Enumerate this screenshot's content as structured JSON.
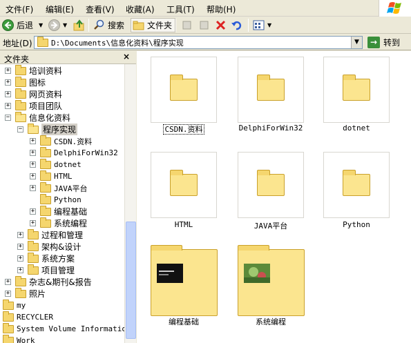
{
  "menu": {
    "file": "文件(F)",
    "edit": "编辑(E)",
    "view": "查看(V)",
    "favorites": "收藏(A)",
    "tools": "工具(T)",
    "help": "帮助(H)"
  },
  "toolbar": {
    "back": "后退",
    "search": "搜索",
    "folders": "文件夹"
  },
  "address": {
    "label": "地址(D)",
    "value": "D:\\Documents\\信息化资料\\程序实现",
    "go": "转到"
  },
  "folders_pane": {
    "title": "文件夹",
    "close": "×"
  },
  "tree": [
    {
      "label": "培训资料",
      "expander": "+"
    },
    {
      "label": "图标",
      "expander": "+"
    },
    {
      "label": "网页资料",
      "expander": "+"
    },
    {
      "label": "项目团队",
      "expander": "+"
    },
    {
      "label": "信息化资料",
      "expander": "−"
    },
    {
      "label": "程序实现",
      "expander": "−"
    },
    {
      "label": "CSDN.资料",
      "expander": "+"
    },
    {
      "label": "DelphiForWin32",
      "expander": "+"
    },
    {
      "label": "dotnet",
      "expander": "+"
    },
    {
      "label": "HTML",
      "expander": "+"
    },
    {
      "label": "JAVA平台",
      "expander": "+"
    },
    {
      "label": "Python",
      "expander": ""
    },
    {
      "label": "编程基础",
      "expander": "+"
    },
    {
      "label": "系统编程",
      "expander": "+"
    },
    {
      "label": "过程和管理",
      "expander": "+"
    },
    {
      "label": "架构&设计",
      "expander": "+"
    },
    {
      "label": "系统方案",
      "expander": "+"
    },
    {
      "label": "项目管理",
      "expander": "+"
    },
    {
      "label": "杂志&期刊&报告",
      "expander": "+"
    },
    {
      "label": "照片",
      "expander": "+"
    },
    {
      "label": "my",
      "expander": ""
    },
    {
      "label": "RECYCLER",
      "expander": ""
    },
    {
      "label": "System Volume Information",
      "expander": ""
    },
    {
      "label": "Work",
      "expander": ""
    }
  ],
  "content": {
    "items": [
      {
        "label": "CSDN.资料"
      },
      {
        "label": "DelphiForWin32"
      },
      {
        "label": "dotnet"
      },
      {
        "label": "HTML"
      },
      {
        "label": "JAVA平台"
      },
      {
        "label": "Python"
      },
      {
        "label": "编程基础"
      },
      {
        "label": "系统编程"
      }
    ]
  },
  "colors": {
    "folder": "#f5d66e",
    "selection": "#d4d0c8",
    "scroll_thumb": "#c1d3fb",
    "go_green": "#3a8f3a"
  }
}
